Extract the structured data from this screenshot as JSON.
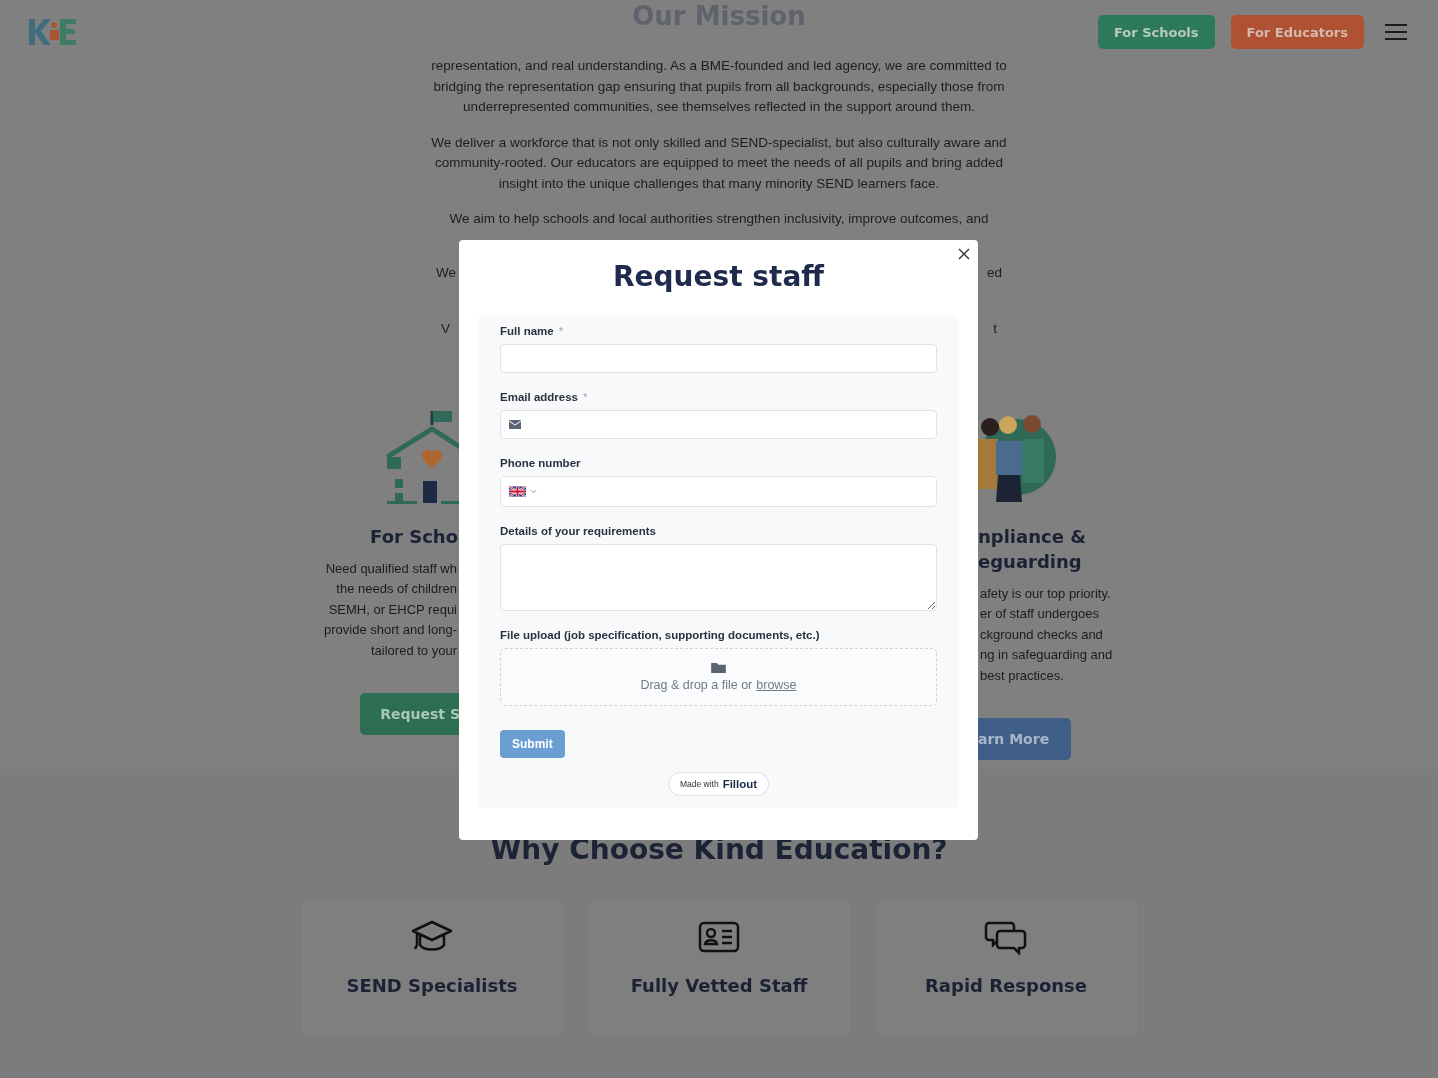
{
  "header": {
    "buttons": [
      {
        "label": "For Schools",
        "kind": "schools"
      },
      {
        "label": "For Educators",
        "kind": "educators"
      }
    ]
  },
  "mission": {
    "title": "Our Mission",
    "paragraphs": [
      "representation, and real understanding. As a BME-founded and led agency, we are committed to bridging the representation gap ensuring that pupils from all backgrounds, especially those from underrepresented communities, see themselves reflected in the support around them.",
      "We deliver a workforce that is not only skilled and SEND-specialist, but also culturally aware and community-rooted. Our educators are equipped to meet the needs of all pupils and bring added insight into the unique challenges that many minority SEND learners face.",
      "We aim to help schools and local authorities strengthen inclusivity, improve outcomes, and"
    ],
    "fragments": [
      {
        "left": "We",
        "right": "ed"
      },
      {
        "left": "V",
        "right": "t"
      }
    ]
  },
  "cards": [
    {
      "kind": "school",
      "title_lines": [
        "For Scho"
      ],
      "lines": [
        "Need qualified staff wh",
        "the needs of children",
        "SEMH, or EHCP requi",
        "provide short and long-",
        "tailored to your"
      ],
      "button": "Request S"
    },
    {
      "kind": "people",
      "title_lines": [
        "npliance &",
        "eguarding"
      ],
      "lines": [
        "afety is our top priority.",
        "er of staff undergoes",
        "ckground checks and",
        "ng in safeguarding and",
        "best practices."
      ],
      "button": "arn More"
    }
  ],
  "modal": {
    "title": "Request staff",
    "fields": [
      {
        "kind": "text",
        "label": "Full name",
        "required_mark": "*"
      },
      {
        "kind": "email",
        "label": "Email address",
        "required_mark": "*"
      },
      {
        "kind": "phone",
        "label": "Phone number"
      },
      {
        "kind": "textarea",
        "label": "Details of your requirements"
      },
      {
        "kind": "file",
        "label": "File upload (job specification, supporting documents, etc.)",
        "prompt": "Drag & drop a file or",
        "link": "browse"
      }
    ],
    "submit": "Submit",
    "badge": {
      "prefix": "Made with",
      "brand": "Fillout"
    }
  },
  "why": {
    "title": "Why Choose Kind Education?",
    "features": [
      {
        "kind": "cap",
        "title": "SEND Specialists"
      },
      {
        "kind": "id",
        "title": "Fully Vetted Staff"
      },
      {
        "kind": "chat",
        "title": "Rapid Response"
      }
    ]
  }
}
